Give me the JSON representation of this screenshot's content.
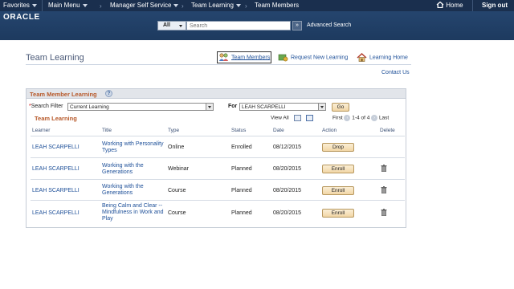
{
  "topnav": {
    "favorites": "Favorites",
    "main_menu": "Main Menu",
    "breadcrumbs": [
      "Manager Self Service",
      "Team Learning",
      "Team Members"
    ],
    "home": "Home",
    "sign_out": "Sign out"
  },
  "header": {
    "logo": "ORACLE",
    "search_scope": "All",
    "search_placeholder": "Search",
    "advanced_search": "Advanced Search"
  },
  "page": {
    "title": "Team Learning",
    "links": {
      "team_members": "Team Members",
      "request_new_learning": "Request New Learning",
      "learning_home": "Learning Home",
      "contact_us": "Contact Us"
    }
  },
  "group": {
    "title": "Team Member Learning",
    "search_filter_label": "Search Filter",
    "search_filter_value": "Current Learning",
    "for_label": "For",
    "for_value": "LEAH SCARPELLI",
    "go": "Go"
  },
  "grid": {
    "title": "Team Learning",
    "view_all": "View All",
    "first": "First",
    "range": "1-4 of 4",
    "last": "Last",
    "columns": [
      "Learner",
      "Title",
      "Type",
      "Status",
      "Date",
      "Action",
      "Delete"
    ],
    "rows": [
      {
        "learner": "LEAH SCARPELLI",
        "title": "Working with Personality Types",
        "type": "Online",
        "status": "Enrolled",
        "date": "08/12/2015",
        "action": "Drop",
        "delete": false
      },
      {
        "learner": "LEAH SCARPELLI",
        "title": "Working with the Generations",
        "type": "Webinar",
        "status": "Planned",
        "date": "08/20/2015",
        "action": "Enroll",
        "delete": true
      },
      {
        "learner": "LEAH SCARPELLI",
        "title": "Working with the Generations",
        "type": "Course",
        "status": "Planned",
        "date": "08/20/2015",
        "action": "Enroll",
        "delete": true
      },
      {
        "learner": "LEAH SCARPELLI",
        "title": "Being Calm and Clear -- Mindfulness in Work and Play",
        "type": "Course",
        "status": "Planned",
        "date": "08/20/2015",
        "action": "Enroll",
        "delete": true
      }
    ]
  },
  "colors": {
    "nav_bg": "#1a2f4e",
    "header_bg": "#1d3a5f",
    "accent_title": "#b7592a",
    "link": "#1d4f98"
  }
}
